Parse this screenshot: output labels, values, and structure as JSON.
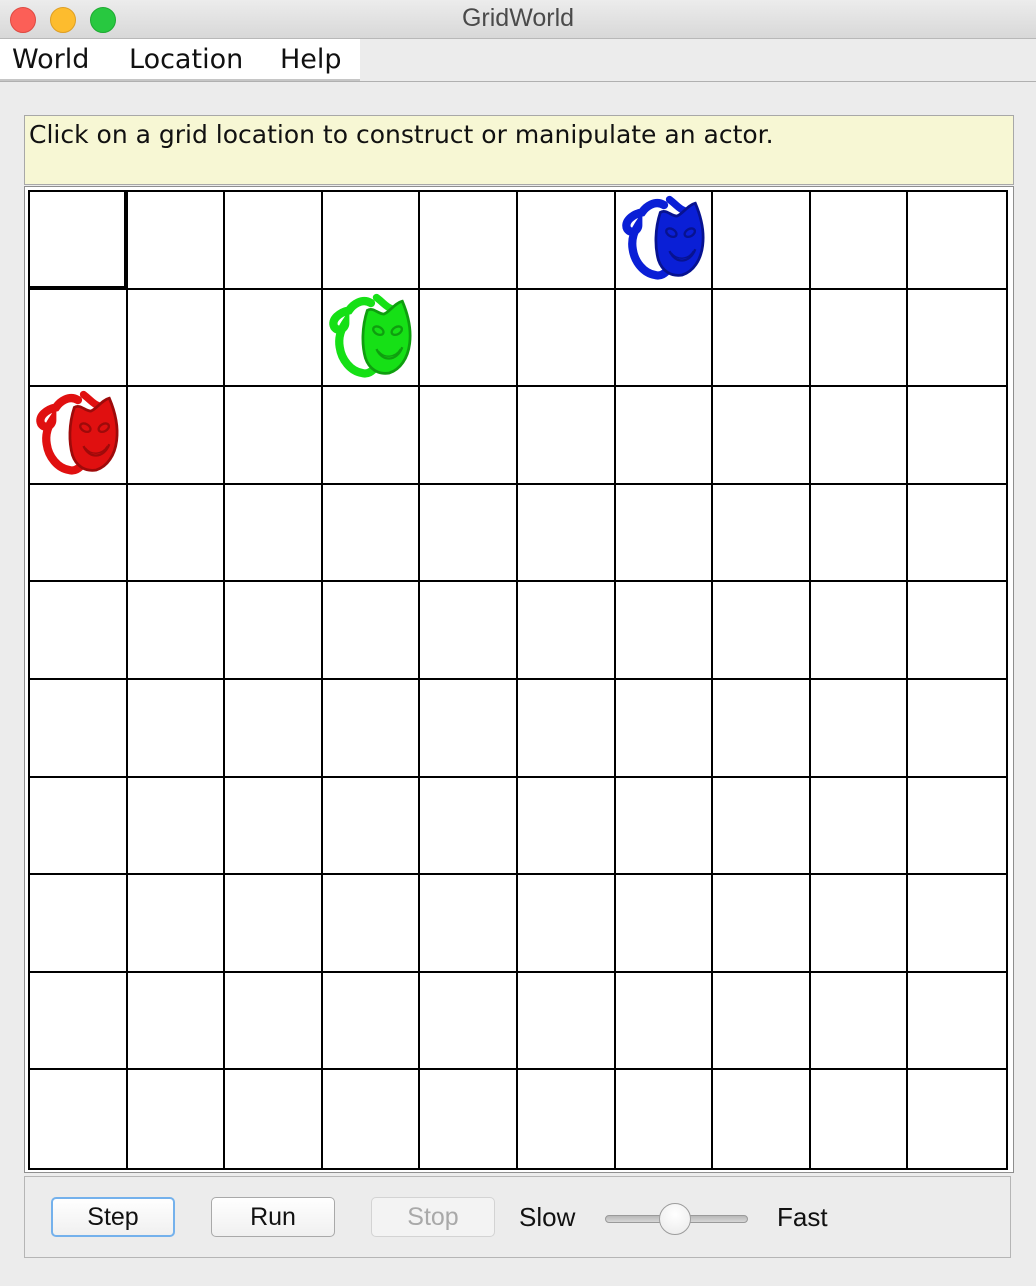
{
  "window": {
    "title": "GridWorld"
  },
  "menu": {
    "items": [
      "World",
      "Location",
      "Help"
    ]
  },
  "message": "Click on a grid location to construct or manipulate an actor.",
  "grid": {
    "rows": 10,
    "cols": 10,
    "selected": {
      "row": 0,
      "col": 0
    },
    "actors": [
      {
        "row": 0,
        "col": 6,
        "color": "#0a1fd6",
        "dark": "#071290",
        "icon": "mask-icon"
      },
      {
        "row": 1,
        "col": 3,
        "color": "#16e016",
        "dark": "#0f9e0f",
        "icon": "mask-icon"
      },
      {
        "row": 2,
        "col": 0,
        "color": "#e01010",
        "dark": "#9e0a0a",
        "icon": "mask-icon"
      }
    ]
  },
  "controls": {
    "step_label": "Step",
    "run_label": "Run",
    "stop_label": "Stop",
    "slow_label": "Slow",
    "fast_label": "Fast",
    "speed_value": 0.49
  }
}
